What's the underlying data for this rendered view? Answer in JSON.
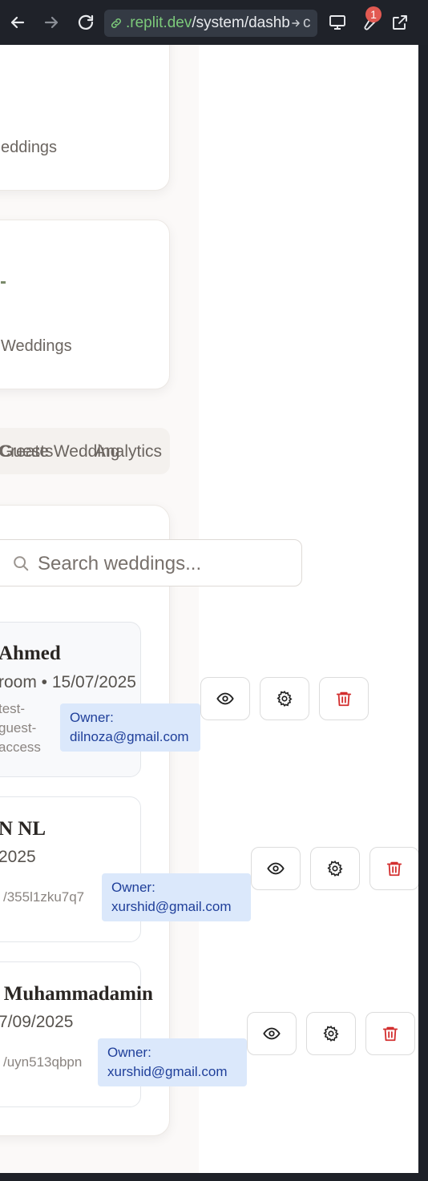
{
  "browser": {
    "url_domain": ".replit.dev",
    "url_path": "/system/dashb",
    "url_tail": "c",
    "notification_count": "1",
    "icons": [
      "back-arrow-icon",
      "forward-arrow-icon",
      "reload-icon",
      "link-icon",
      "monitor-icon",
      "wrench-icon",
      "external-link-icon"
    ]
  },
  "stats": [
    {
      "label": "eddings"
    },
    {
      "label": "Weddings"
    }
  ],
  "tabs": [
    {
      "label": "Create Wedding"
    },
    {
      "label": "Guests"
    },
    {
      "label": "Analytics"
    }
  ],
  "search": {
    "placeholder": "Search weddings..."
  },
  "weddings": [
    {
      "name": "Ahmed",
      "subtitle": "room • 15/07/2025",
      "slug": "test-\nguest-\naccess",
      "owner": "Owner:\ndilnoza@gmail.com"
    },
    {
      "name": "N NL",
      "subtitle": "2025",
      "slug": "/355l1zku7q7",
      "owner": "Owner:\nxurshid@gmail.com"
    },
    {
      "name": "’ Muhammadamin",
      "subtitle": "7/09/2025",
      "slug": "/uyn513qbpn",
      "owner": "Owner:\nxurshid@gmail.com"
    }
  ],
  "colors": {
    "delete_red": "#d32f2f",
    "owner_badge_bg": "#dbe8fb",
    "owner_badge_text": "#1f3f9a",
    "url_domain_green": "#7cc97a"
  }
}
